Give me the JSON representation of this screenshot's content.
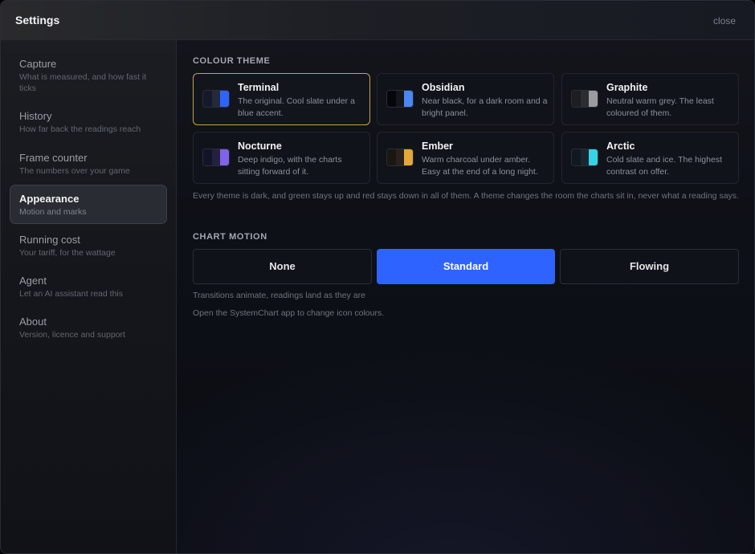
{
  "window": {
    "title": "Settings",
    "close_label": "close"
  },
  "sidebar": {
    "items": [
      {
        "label": "Capture",
        "sub": "What is measured, and how fast it ticks",
        "active": false
      },
      {
        "label": "History",
        "sub": "How far back the readings reach",
        "active": false
      },
      {
        "label": "Frame counter",
        "sub": "The numbers over your game",
        "active": false
      },
      {
        "label": "Appearance",
        "sub": "Motion and marks",
        "active": true
      },
      {
        "label": "Running cost",
        "sub": "Your tariff, for the wattage",
        "active": false
      },
      {
        "label": "Agent",
        "sub": "Let an AI assistant read this",
        "active": false
      },
      {
        "label": "About",
        "sub": "Version, licence and support",
        "active": false
      }
    ]
  },
  "colour_theme": {
    "heading": "COLOUR THEME",
    "selected": "Terminal",
    "themes": [
      {
        "name": "Terminal",
        "desc": "The original. Cool slate under a blue accent.",
        "swatch": [
          "#15192a",
          "#232a3c",
          "#2f63ff"
        ]
      },
      {
        "name": "Obsidian",
        "desc": "Near black, for a dark room and a bright panel.",
        "swatch": [
          "#06070a",
          "#14161b",
          "#4b86f4"
        ]
      },
      {
        "name": "Graphite",
        "desc": "Neutral warm grey. The least coloured of them.",
        "swatch": [
          "#1d1e21",
          "#2c2d31",
          "#9a9ba0"
        ]
      },
      {
        "name": "Nocturne",
        "desc": "Deep indigo, with the charts sitting forward of it.",
        "swatch": [
          "#141429",
          "#23213f",
          "#7f63ea"
        ]
      },
      {
        "name": "Ember",
        "desc": "Warm charcoal under amber. Easy at the end of a long night.",
        "swatch": [
          "#1a1612",
          "#2a221a",
          "#e3a838"
        ]
      },
      {
        "name": "Arctic",
        "desc": "Cold slate and ice. The highest contrast on offer.",
        "swatch": [
          "#111820",
          "#1c2630",
          "#35d3e6"
        ]
      }
    ],
    "note": "Every theme is dark, and green stays up and red stays down in all of them. A theme changes the room the charts sit in, never what a reading says."
  },
  "chart_motion": {
    "heading": "CHART MOTION",
    "options": [
      "None",
      "Standard",
      "Flowing"
    ],
    "selected": "Standard",
    "note": "Transitions animate, readings land as they are",
    "footer": "Open the SystemChart app to change icon colours."
  }
}
